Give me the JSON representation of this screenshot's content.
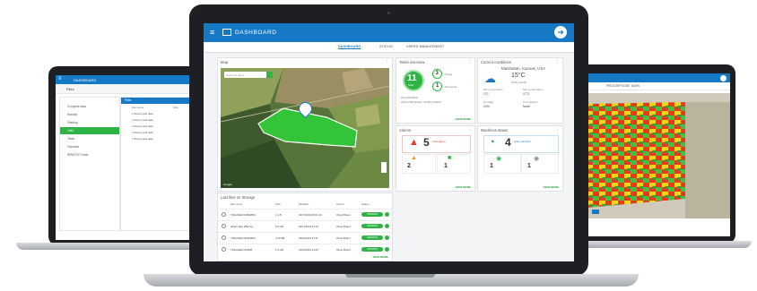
{
  "app": {
    "title": "DASHBOARD",
    "accent": "#1679c6",
    "success": "#2fb344"
  },
  "tabs": [
    {
      "label": "DASHBOARD",
      "active": true
    },
    {
      "label": "STATUS",
      "active": false
    },
    {
      "label": "USERS MANAGEMENT",
      "active": false
    }
  ],
  "map_card": {
    "title": "Map",
    "search_placeholder": "Search a place",
    "credit": "Google"
  },
  "tasks_card": {
    "title": "Tasks overview",
    "total": "11",
    "total_label": "Tasks",
    "done_count": "3",
    "done_label": "Today",
    "pending_count": "1",
    "pending_label": "Tomorrow",
    "line1": "HALLS/FIELD",
    "line2": "HOLLAND ROAD, NORTH FIELD",
    "view_more": "VIEW MORE"
  },
  "conditions_card": {
    "title": "Current conditions",
    "location": "Manhattan, Kansas, USA",
    "temperature": "15°C",
    "description": "Partly cloudy",
    "stats": [
      {
        "label": "Min temperature",
        "value": "1°C"
      },
      {
        "label": "Max temperature",
        "value": "17°C"
      },
      {
        "label": "Humidity",
        "value": "24%"
      },
      {
        "label": "Precipitation",
        "value": "None"
      }
    ]
  },
  "alarms_card": {
    "title": "Alarms",
    "total": "5",
    "total_label": "Open alarms",
    "left_count": "2",
    "right_count": "1",
    "view_more": "VIEW MORE"
  },
  "machines_card": {
    "title": "Machines status",
    "total": "4",
    "total_label": "active machines",
    "left_count": "1",
    "right_count": "1",
    "view_more": "VIEW MORE"
  },
  "files_card": {
    "title": "Last files on Storage",
    "columns": [
      "File name",
      "Size",
      "Modified",
      "Owner",
      "Status"
    ],
    "rows": [
      {
        "name": "TRACKER-0195H8DS",
        "size": "1.1 B",
        "modified": "04/17/2019 00:01:34",
        "owner": "Oliver Brand",
        "status": "UPDATED"
      },
      {
        "name": "uPlant Map Wall Sa...",
        "size": "8.0 GB",
        "modified": "04/17/2019 01:13",
        "owner": "Oliver Brand",
        "status": "UPDATED"
      },
      {
        "name": "TRACKER-0195H8DS",
        "size": "2.22 MB",
        "modified": "04/16/2019 13:11",
        "owner": "Oliver Brand",
        "status": "UPDATED"
      },
      {
        "name": "TRACKER-0195H8",
        "size": "1.9 GB",
        "modified": "04/16/2019 12:05",
        "owner": "Oliver Brand",
        "status": "UPDATED"
      }
    ],
    "view_more": "VIEW MORE"
  },
  "left_screen": {
    "title": "DASHBOARD",
    "section": "Files",
    "nav": [
      "Complete data",
      "Harvest",
      "Planting",
      "Yield",
      "Tasks",
      "Favorites",
      "REMOTE Folder"
    ],
    "header": "Files",
    "columns": [
      "File name",
      "Size",
      "Date"
    ],
    "rows": [
      "2 Stored yield data",
      "2 Stored yield data",
      "2 Stored yield data",
      "2 Stored yield data",
      "2 Stored yield data"
    ]
  },
  "right_screen": {
    "tab1": "PRESCRIPTIONS",
    "tab2": "MAPS"
  }
}
